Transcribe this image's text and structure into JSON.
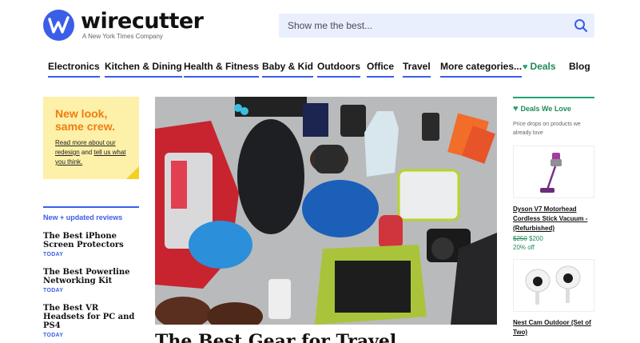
{
  "header": {
    "logo_word": "wirecutter",
    "logo_sub": "A New York Times Company",
    "search_placeholder": "Show me the best..."
  },
  "nav": {
    "items": [
      "Electronics",
      "Kitchen & Dining",
      "Health & Fitness",
      "Baby & Kid",
      "Outdoors",
      "Office",
      "Travel",
      "More categories..."
    ],
    "deals": "Deals",
    "blog": "Blog"
  },
  "note": {
    "title": "New look, same crew.",
    "read_more": "Read more about our redesign",
    "and": " and ",
    "tell_us": "tell us what you think."
  },
  "reviews": {
    "heading": "New + updated reviews",
    "items": [
      {
        "title": "The Best iPhone Screen Protectors",
        "date": "TODAY"
      },
      {
        "title": "The Best Powerline Networking Kit",
        "date": "TODAY"
      },
      {
        "title": "The Best VR Headsets for PC and PS4",
        "date": "TODAY"
      }
    ]
  },
  "hero": {
    "title": "The Best Gear for Travel"
  },
  "deals_col": {
    "heading": "Deals We Love",
    "sub": "Price drops on products we already love",
    "items": [
      {
        "name": "Dyson V7 Motorhead Cordless Stick Vacuum - (Refurbished)",
        "old_price": "$250",
        "new_price": "$200",
        "off": "20% off"
      },
      {
        "name": "Nest Cam Outdoor (Set of Two)"
      }
    ]
  },
  "colors": {
    "accent_blue": "#3b5ee8",
    "deal_green": "#1f8a5a",
    "note_yellow": "#fdf0a8",
    "note_orange": "#f07d10"
  }
}
